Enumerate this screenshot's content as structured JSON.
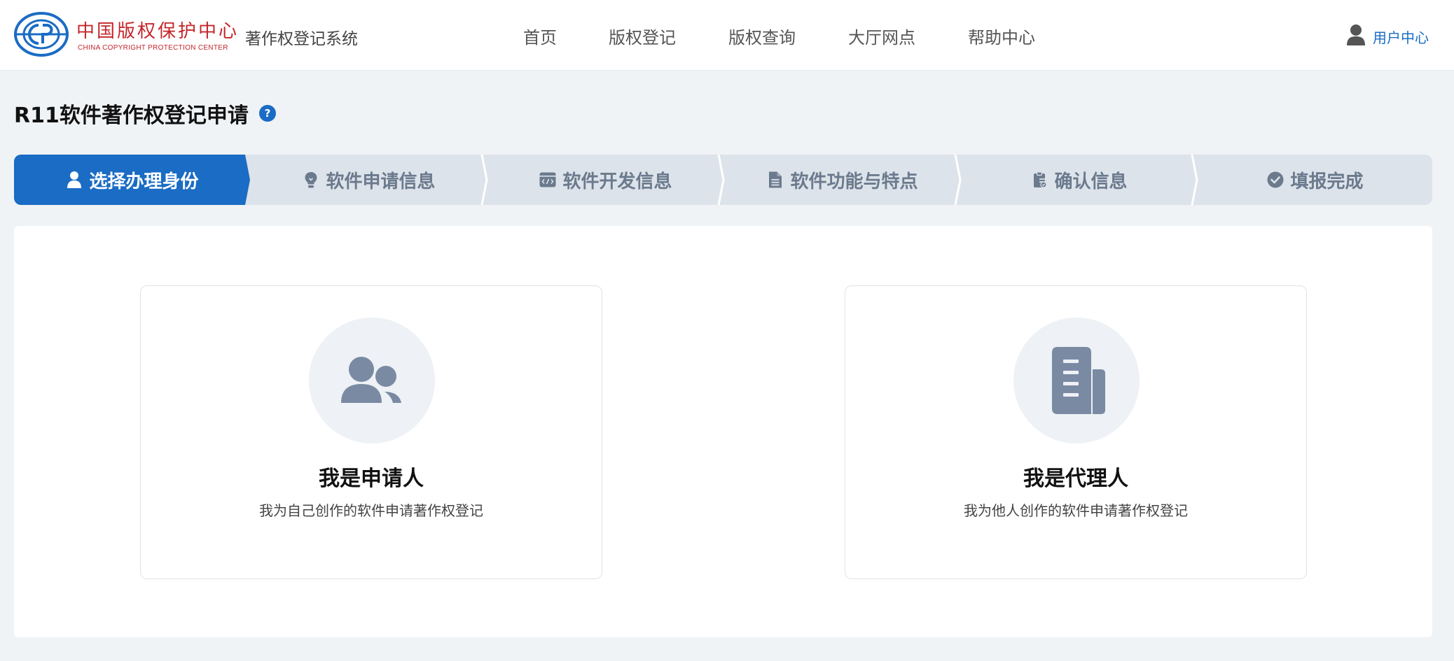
{
  "brand": {
    "logo_cn": "中国版权保护中心",
    "logo_en": "CHINA COPYRIGHT PROTECTION CENTER",
    "system_name": "著作权登记系统",
    "color": "#c4262c"
  },
  "nav": {
    "items": [
      "首页",
      "版权登记",
      "版权查询",
      "大厅网点",
      "帮助中心"
    ],
    "user_center": "用户中心"
  },
  "page": {
    "title": "R11软件著作权登记申请",
    "help": "?"
  },
  "steps": [
    {
      "label": "选择办理身份",
      "icon": "user-icon",
      "active": true
    },
    {
      "label": "软件申请信息",
      "icon": "lightbulb-icon",
      "active": false
    },
    {
      "label": "软件开发信息",
      "icon": "code-window-icon",
      "active": false
    },
    {
      "label": "软件功能与特点",
      "icon": "document-icon",
      "active": false
    },
    {
      "label": "确认信息",
      "icon": "clipboard-icon",
      "active": false
    },
    {
      "label": "填报完成",
      "icon": "check-circle-icon",
      "active": false
    }
  ],
  "cards": [
    {
      "title": "我是申请人",
      "desc": "我为自己创作的软件申请著作权登记",
      "icon": "users-icon"
    },
    {
      "title": "我是代理人",
      "desc": "我为他人创作的软件申请著作权登记",
      "icon": "building-icon"
    }
  ],
  "colors": {
    "primary": "#1a6cc4",
    "step_active_bg": "#1a6cc4",
    "step_inactive_bg": "#dde3ea",
    "icon_gray": "#7a8aa3"
  }
}
